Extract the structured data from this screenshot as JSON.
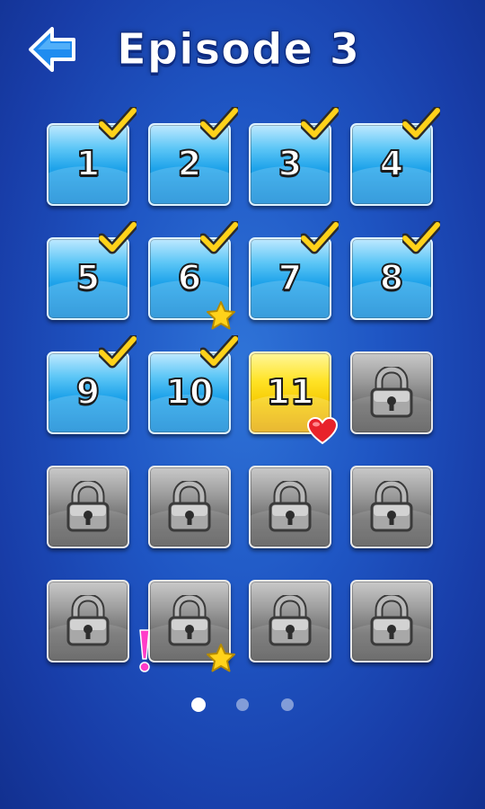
{
  "header": {
    "back_icon": "left-arrow-icon",
    "title": "Episode 3"
  },
  "levels": [
    {
      "number": "1",
      "state": "completed",
      "checked": true
    },
    {
      "number": "2",
      "state": "completed",
      "checked": true
    },
    {
      "number": "3",
      "state": "completed",
      "checked": true
    },
    {
      "number": "4",
      "state": "completed",
      "checked": true
    },
    {
      "number": "5",
      "state": "completed",
      "checked": true
    },
    {
      "number": "6",
      "state": "completed",
      "checked": true,
      "badge": "star-icon"
    },
    {
      "number": "7",
      "state": "completed",
      "checked": true
    },
    {
      "number": "8",
      "state": "completed",
      "checked": true
    },
    {
      "number": "9",
      "state": "completed",
      "checked": true
    },
    {
      "number": "10",
      "state": "completed",
      "checked": true
    },
    {
      "number": "11",
      "state": "current",
      "checked": false,
      "badge": "heart-icon"
    },
    {
      "number": "",
      "state": "locked"
    },
    {
      "number": "",
      "state": "locked"
    },
    {
      "number": "",
      "state": "locked"
    },
    {
      "number": "",
      "state": "locked"
    },
    {
      "number": "",
      "state": "locked"
    },
    {
      "number": "",
      "state": "locked"
    },
    {
      "number": "",
      "state": "locked",
      "badge": "star-icon",
      "alert": "exclamation-icon"
    },
    {
      "number": "",
      "state": "locked"
    },
    {
      "number": "",
      "state": "locked"
    }
  ],
  "pager": {
    "pages": 3,
    "current": 1
  },
  "colors": {
    "background": "#1f56c4",
    "completed_tile": "#1fa3ea",
    "current_tile": "#ffe326",
    "locked_tile": "#8a8a8a",
    "check": "#ffd21a",
    "star": "#ffd21a",
    "heart": "#e8222a",
    "alert": "#ff3cc8"
  }
}
